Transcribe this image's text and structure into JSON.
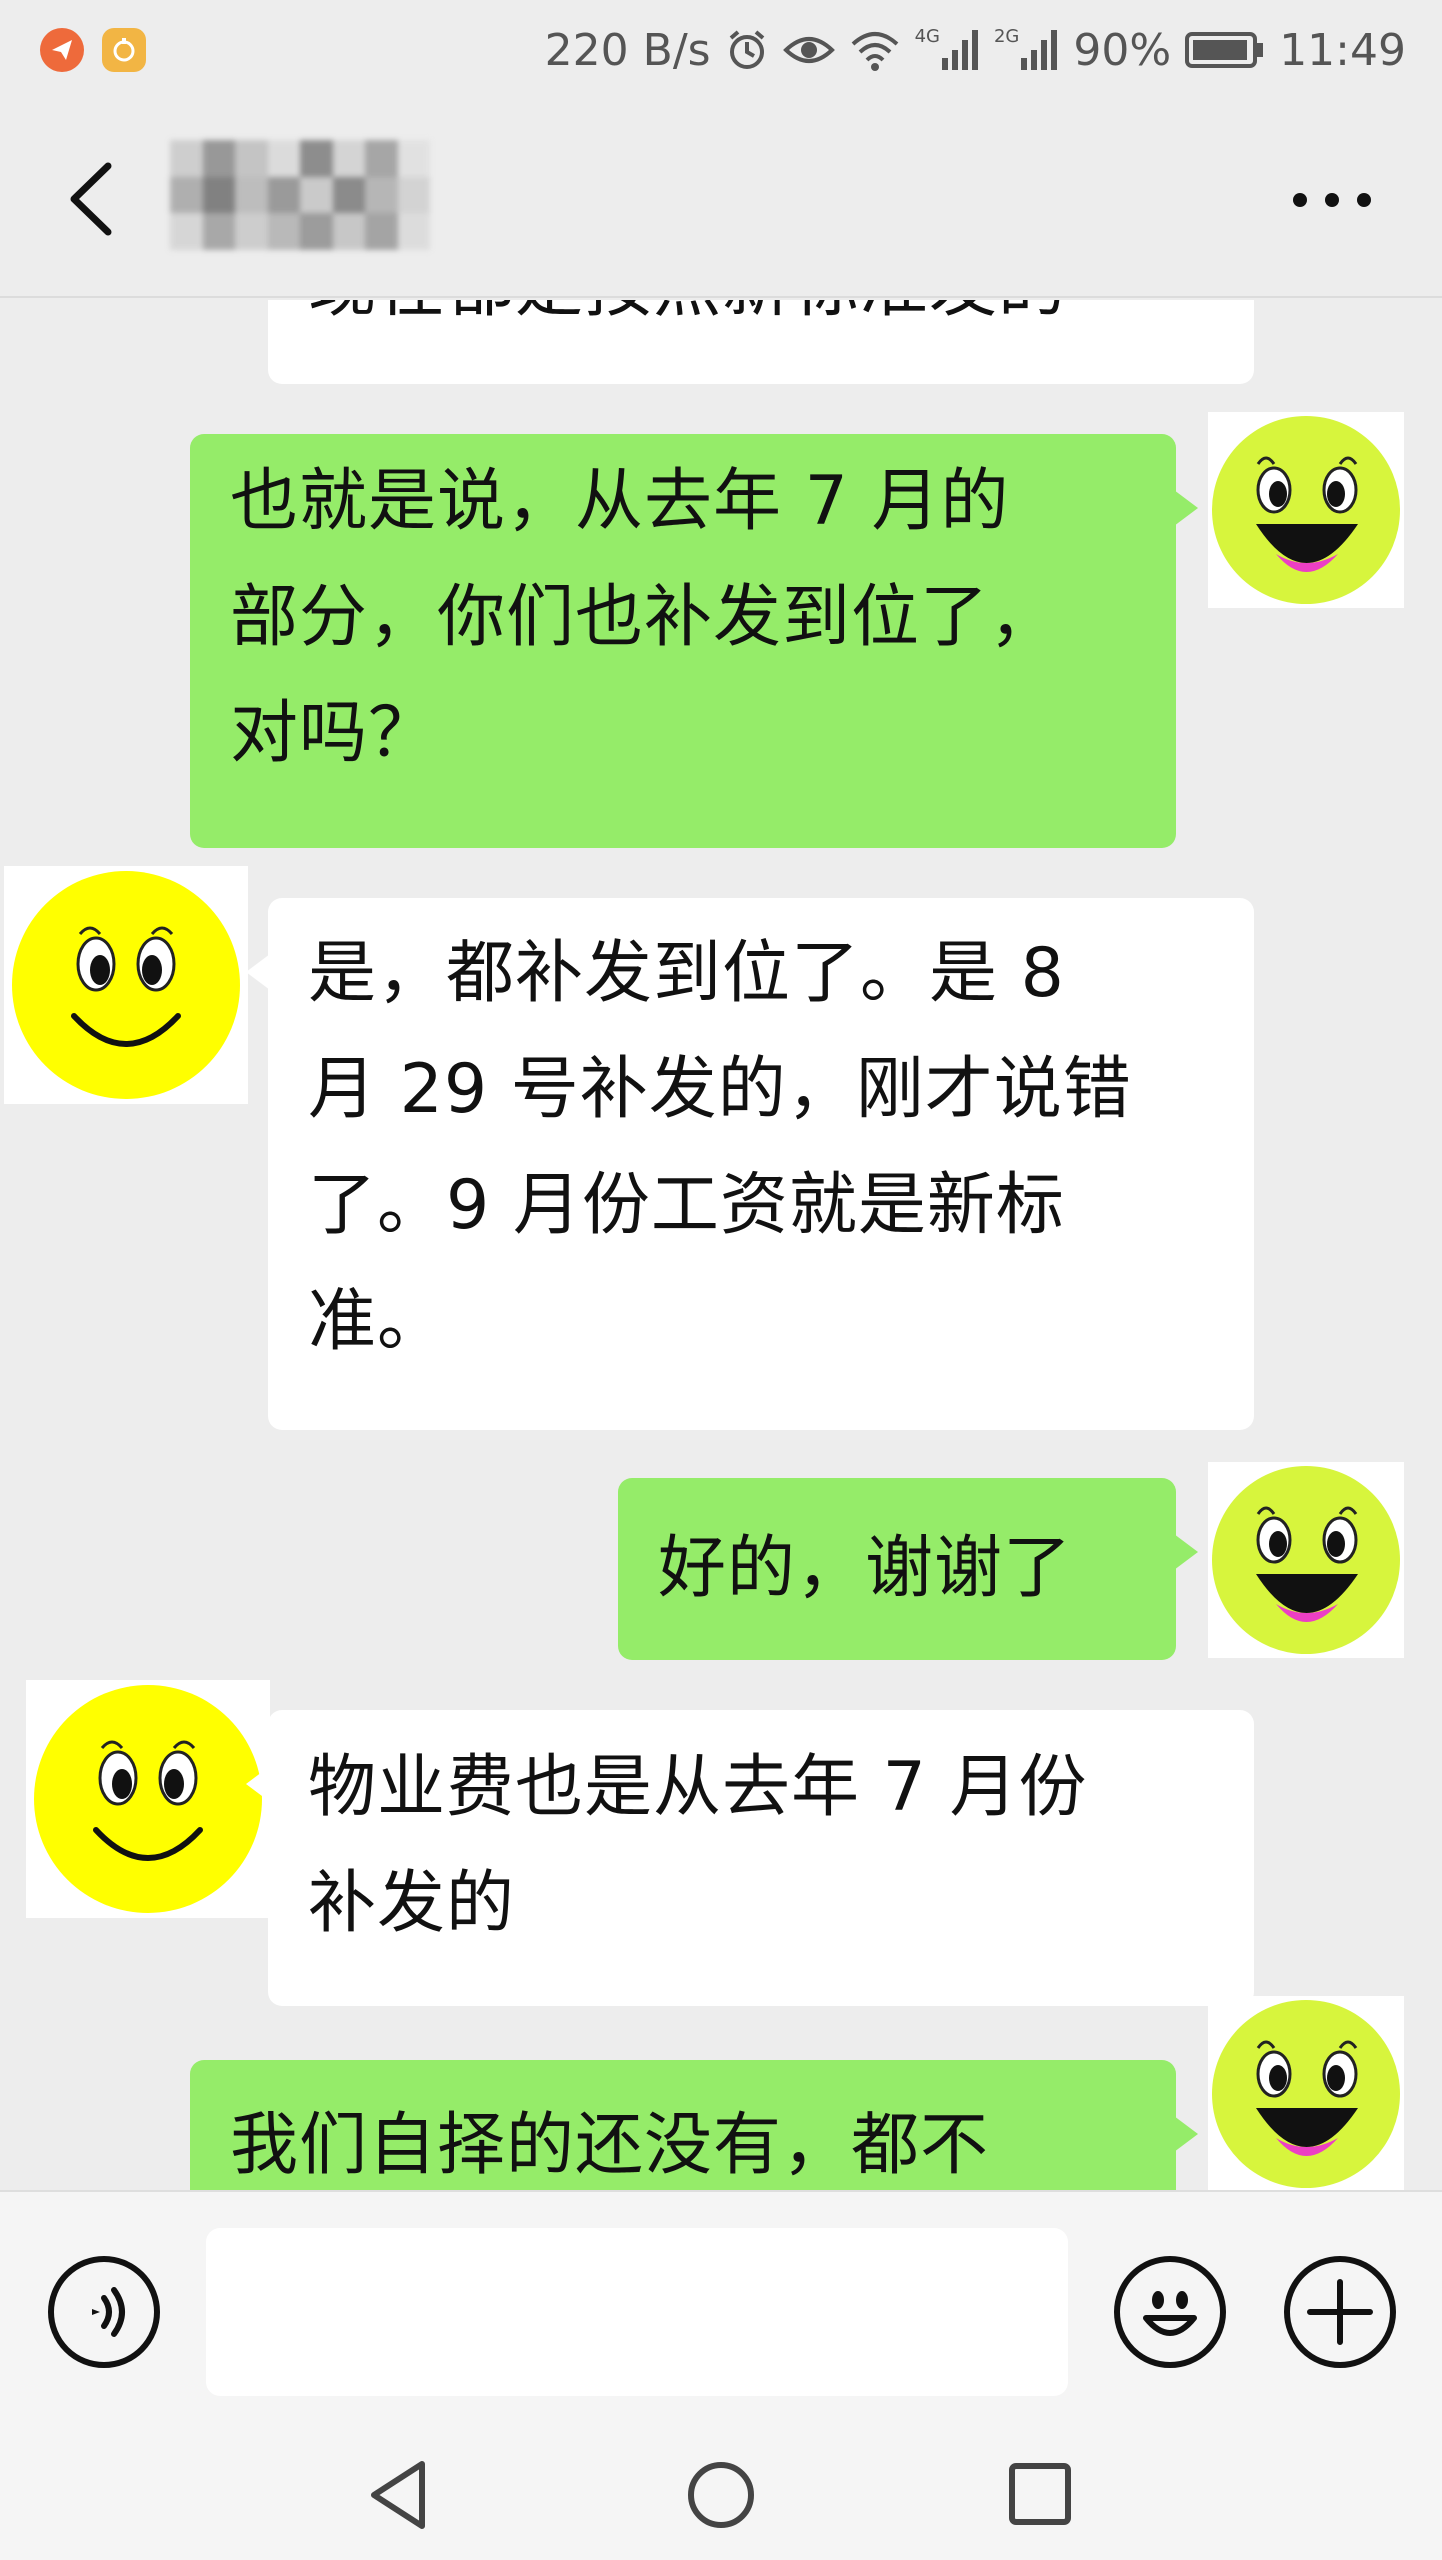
{
  "status_bar": {
    "speed": "220 B/s",
    "net1": "4G",
    "net2": "2G",
    "battery": "90%",
    "time": "11:49"
  },
  "header": {
    "title_obscured": true,
    "back_icon": "chevron-left-icon",
    "more_icon": "more-dots-icon"
  },
  "messages": [
    {
      "side": "in",
      "text_lines": [
        "现在都是按照新标准发的"
      ]
    },
    {
      "side": "out",
      "text_lines": [
        "也就是说，从去年 7 月的",
        "部分，你们也补发到位了，",
        "对吗？"
      ]
    },
    {
      "side": "in",
      "text_lines": [
        "是，都补发到位了。是 8",
        "月 29 号补发的，刚才说错",
        "了。9 月份工资就是新标",
        "准。"
      ]
    },
    {
      "side": "out",
      "text_lines": [
        "好的，谢谢了"
      ]
    },
    {
      "side": "in",
      "text_lines": [
        "物业费也是从去年 7 月份",
        "补发的"
      ]
    },
    {
      "side": "out",
      "text_lines": [
        "我们自择的还没有，都不"
      ]
    }
  ],
  "input_bar": {
    "voice_icon": "voice-icon",
    "text_value": "",
    "emoji_icon": "emoji-icon",
    "plus_icon": "plus-icon"
  },
  "nav_bar": {
    "back": "nav-back-icon",
    "home": "nav-home-icon",
    "recents": "nav-recents-icon"
  },
  "colors": {
    "background": "#ededed",
    "outgoing_bubble": "#95ec69",
    "incoming_bubble": "#ffffff",
    "incoming_avatar": "#ffff00",
    "outgoing_avatar": "#d7f53d"
  }
}
